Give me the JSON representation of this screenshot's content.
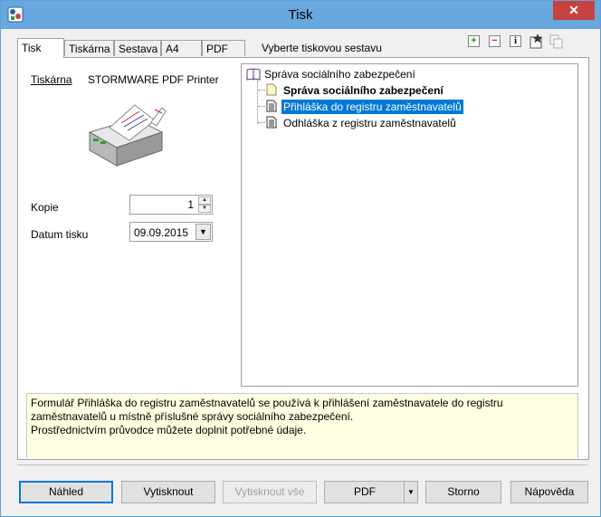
{
  "window": {
    "title": "Tisk",
    "close_symbol": "✕"
  },
  "tabs": [
    {
      "label": "Tisk"
    },
    {
      "label": "Tiskárna"
    },
    {
      "label": "Sestava"
    },
    {
      "label": "A4"
    },
    {
      "label": "PDF"
    }
  ],
  "tab_hint": "Vyberte tiskovou sestavu",
  "toolbar_icons": [
    "add-icon",
    "remove-icon",
    "info-icon",
    "star-icon",
    "copy-icon"
  ],
  "printer": {
    "label": "Tiskárna",
    "value": "STORMWARE PDF Printer"
  },
  "copies": {
    "label": "Kopie",
    "value": "1"
  },
  "print_date": {
    "label": "Datum tisku",
    "value": "09.09.2015"
  },
  "tree": {
    "root": "Správa sociálního zabezpečení",
    "children": [
      "Správa sociálního zabezpečení",
      "Přihláška do registru zaměstnavatelů",
      "Odhláška z registru zaměstnavatelů"
    ]
  },
  "description": {
    "line1": "Formulář Přihláška do registru zaměstnavatelů se používá k přihlášení zaměstnavatele do registru zaměstnavatelů u místně příslušné správy sociálního zabezpečení.",
    "line2": "Prostřednictvím průvodce můžete doplnit potřebné údaje."
  },
  "buttons": {
    "preview": "Náhled",
    "print": "Vytisknout",
    "print_all": "Vytisknout vše",
    "pdf": "PDF",
    "cancel": "Storno",
    "help": "Nápověda"
  },
  "colors": {
    "titlebar": "#69a8de",
    "selection": "#0078d7",
    "close": "#c7413f",
    "info_bg": "#ffffe1"
  }
}
